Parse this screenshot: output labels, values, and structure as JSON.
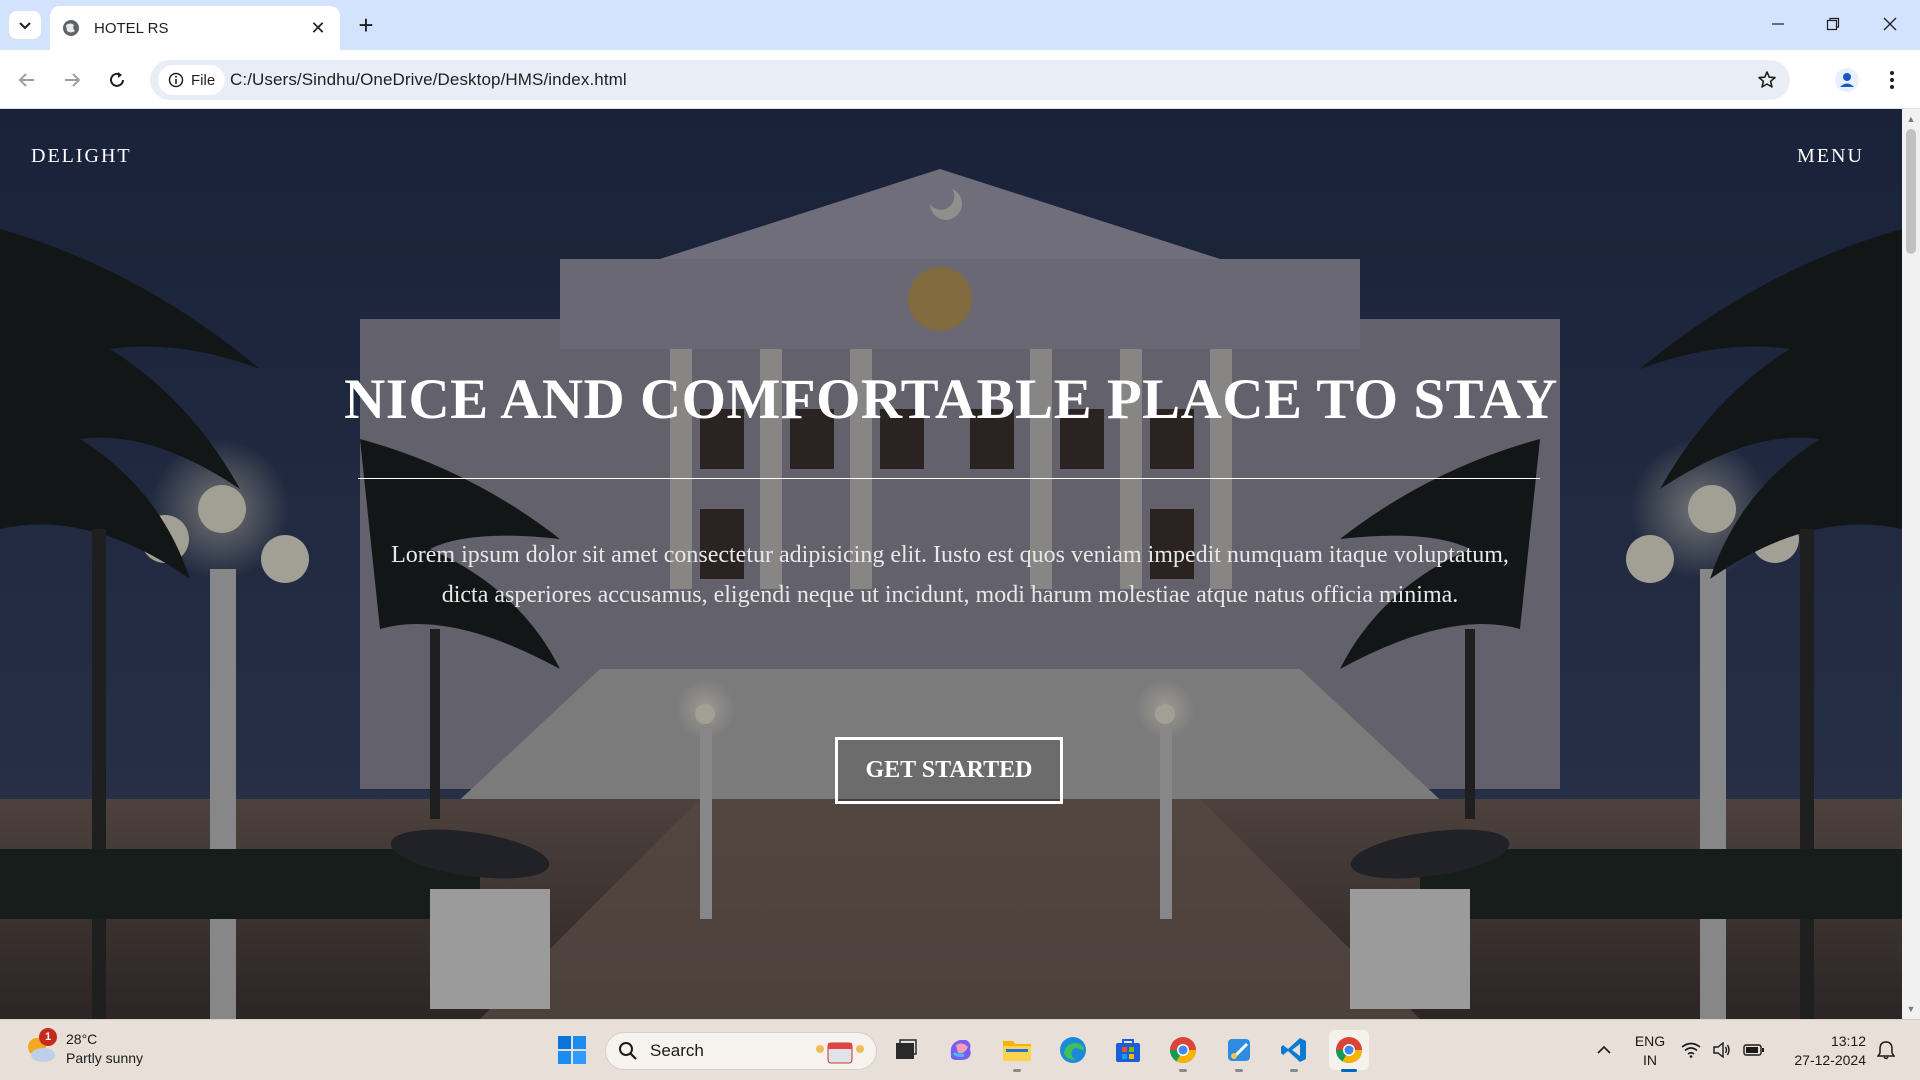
{
  "browser": {
    "tab_title": "HOTEL RS",
    "site_chip_label": "File",
    "url": "C:/Users/Sindhu/OneDrive/Desktop/HMS/index.html"
  },
  "page": {
    "brand": "DELIGHT",
    "menu": "MENU",
    "hero_title": "NICE AND COMFORTABLE PLACE TO STAY",
    "hero_text": "Lorem ipsum dolor sit amet consectetur adipisicing elit. Iusto est quos veniam impedit numquam itaque voluptatum, dicta asperiores accusamus, eligendi neque ut incidunt, modi harum molestiae atque natus officia minima.",
    "cta_label": "GET STARTED"
  },
  "taskbar": {
    "weather_temp": "28°C",
    "weather_desc": "Partly sunny",
    "weather_badge": "1",
    "search_placeholder": "Search",
    "lang_line1": "ENG",
    "lang_line2": "IN",
    "time": "13:12",
    "date": "27-12-2024"
  },
  "colors": {
    "tabbar_bg": "#d3e3fd",
    "omnibox_bg": "#e9eef6",
    "taskbar_bg": "#e8e0d8",
    "accent_blue": "#0067c0"
  }
}
